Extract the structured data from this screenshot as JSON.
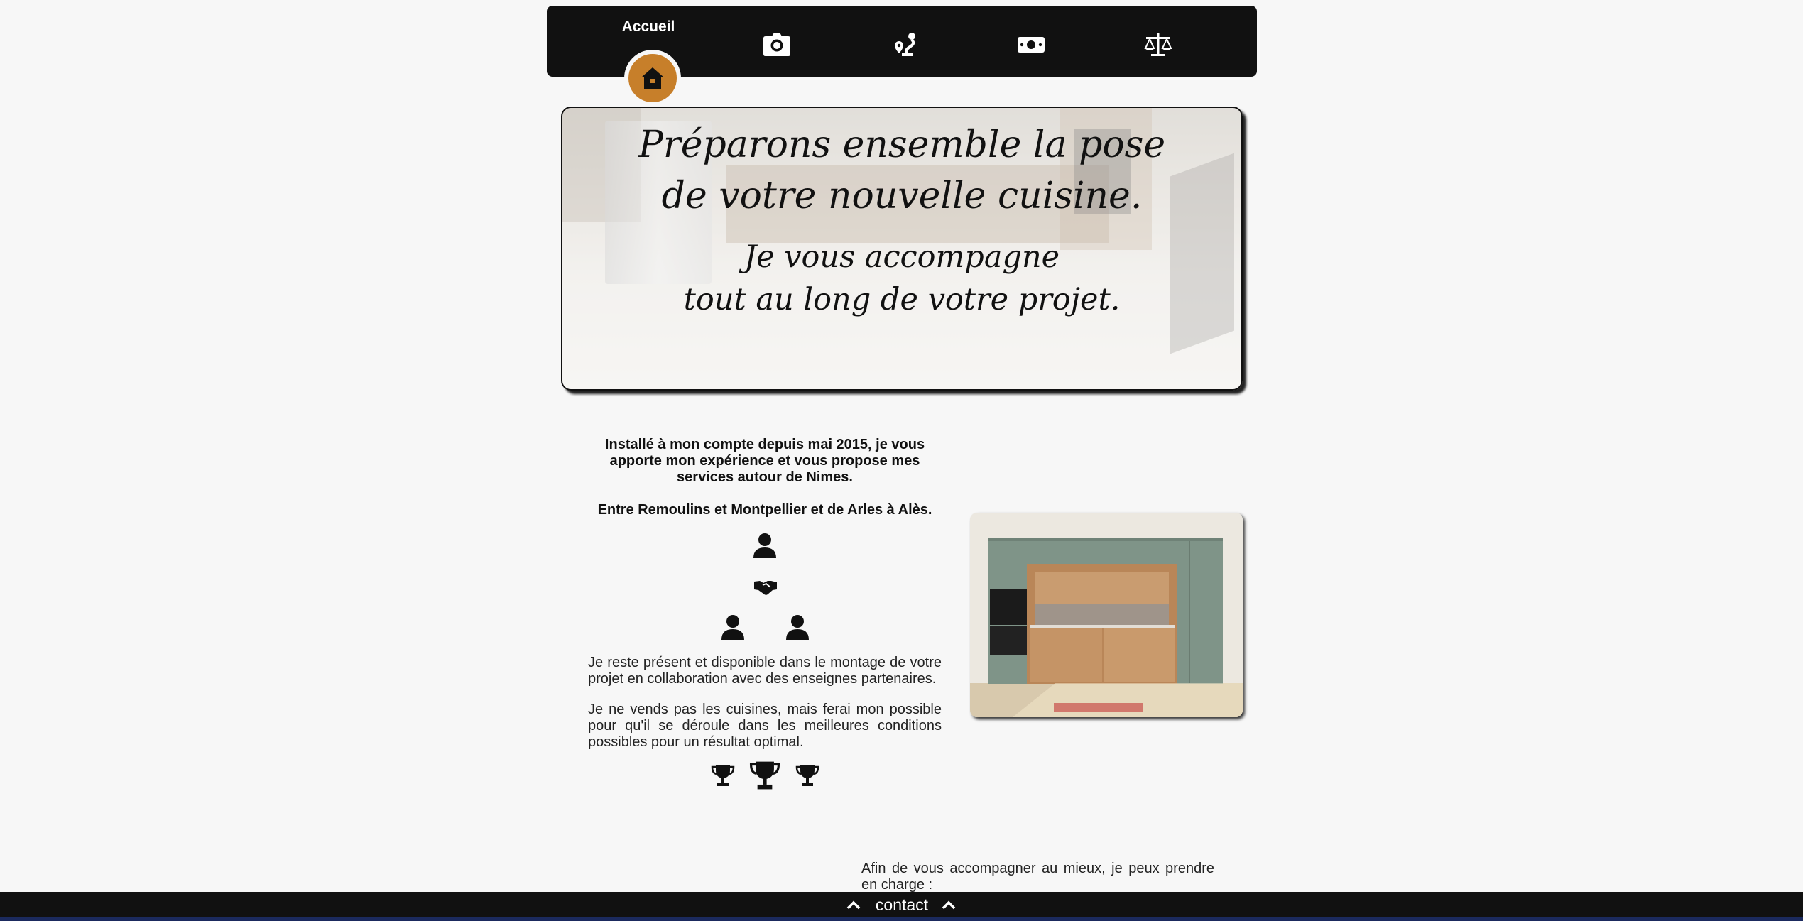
{
  "nav": {
    "active_label": "Accueil",
    "items": [
      {
        "name": "home",
        "icon": "house-icon"
      },
      {
        "name": "photos",
        "icon": "camera-icon"
      },
      {
        "name": "route",
        "icon": "route-icon"
      },
      {
        "name": "pricing",
        "icon": "money-bill-icon"
      },
      {
        "name": "legal",
        "icon": "scale-balance-icon"
      }
    ],
    "accent_color": "#c77f2a"
  },
  "hero": {
    "line1": "Préparons ensemble la pose",
    "line2": "de votre nouvelle cuisine.",
    "line3": "Je vous accompagne",
    "line4": "tout au long de votre projet."
  },
  "intro": {
    "lead": "Installé à mon compte depuis mai 2015, je vous apporte mon expérience et vous propose mes services autour de Nimes.",
    "zone": "Entre Remoulins et Montpellier et de Arles à Alès.",
    "para1": "Je reste présent et disponible dans le montage de votre projet en collaboration avec des enseignes partenaires.",
    "para2": "Je ne vends pas les cuisines, mais ferai mon possible pour qu'il se déroule dans les meilleures conditions possibles pour un résultat optimal."
  },
  "services": {
    "intro": "Afin de vous accompagner au mieux, je peux prendre en charge :"
  },
  "footer": {
    "label": "contact"
  }
}
